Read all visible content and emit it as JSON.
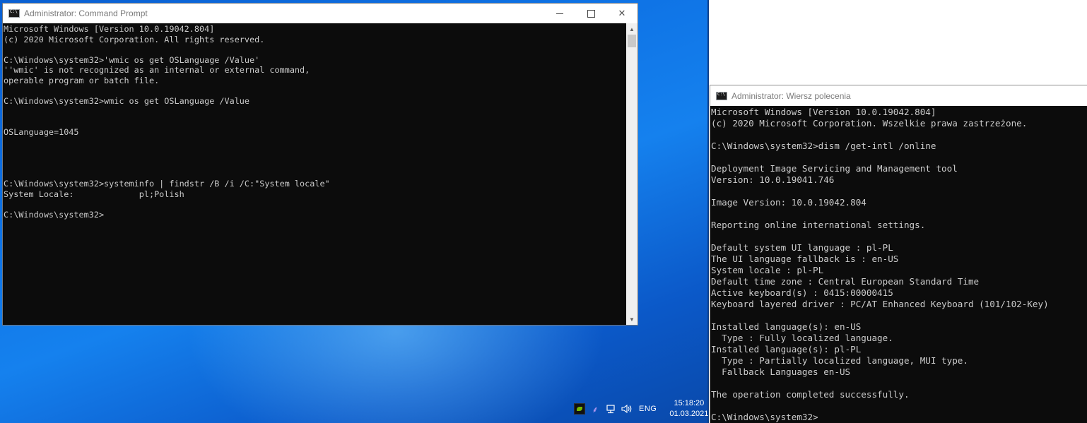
{
  "win1": {
    "title": "Administrator: Command Prompt",
    "controls": {
      "minimize": "—",
      "maximize": "☐",
      "close": "✕"
    },
    "console": "Microsoft Windows [Version 10.0.19042.804]\n(c) 2020 Microsoft Corporation. All rights reserved.\n\nC:\\Windows\\system32>'wmic os get OSLanguage /Value'\n''wmic' is not recognized as an internal or external command,\noperable program or batch file.\n\nC:\\Windows\\system32>wmic os get OSLanguage /Value\n\n\nOSLanguage=1045\n\n\n\n\nC:\\Windows\\system32>systeminfo | findstr /B /i /C:\"System locale\"\nSystem Locale:             pl;Polish\n\nC:\\Windows\\system32>"
  },
  "win2": {
    "title": "Administrator: Wiersz polecenia",
    "console": "Microsoft Windows [Version 10.0.19042.804]\n(c) 2020 Microsoft Corporation. Wszelkie prawa zastrzeżone.\n\nC:\\Windows\\system32>dism /get-intl /online\n\nDeployment Image Servicing and Management tool\nVersion: 10.0.19041.746\n\nImage Version: 10.0.19042.804\n\nReporting online international settings.\n\nDefault system UI language : pl-PL\nThe UI language fallback is : en-US\nSystem locale : pl-PL\nDefault time zone : Central European Standard Time\nActive keyboard(s) : 0415:00000415\nKeyboard layered driver : PC/AT Enhanced Keyboard (101/102-Key)\n\nInstalled language(s): en-US\n  Type : Fully localized language.\nInstalled language(s): pl-PL\n  Type : Partially localized language, MUI type.\n  Fallback Languages en-US\n\nThe operation completed successfully.\n\nC:\\Windows\\system32>"
  },
  "tray": {
    "language": "ENG",
    "time": "15:18:20",
    "date": "01.03.2021",
    "icons": [
      "nvidia-icon",
      "feather-icon",
      "network-icon",
      "volume-icon"
    ]
  }
}
